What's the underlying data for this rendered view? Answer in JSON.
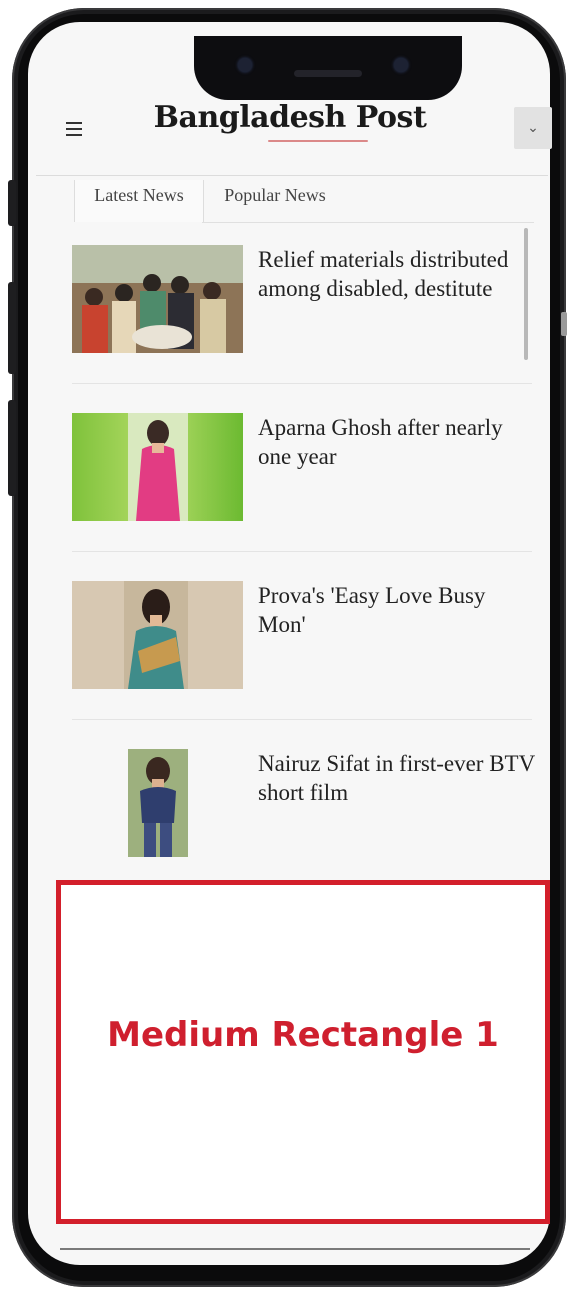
{
  "header": {
    "brand": "Bangladesh Post",
    "menu_icon": "hamburger-menu-icon",
    "dropdown_icon": "chevron-down-icon",
    "dropdown_glyph": "⌄"
  },
  "tabs": [
    {
      "label": "Latest News",
      "active": true
    },
    {
      "label": "Popular News",
      "active": false
    }
  ],
  "news": [
    {
      "headline": "Relief materials distributed among disabled, destitute"
    },
    {
      "headline": "Aparna Ghosh after nearly one year"
    },
    {
      "headline": "Prova's 'Easy Love Busy Mon'"
    },
    {
      "headline": "Nairuz Sifat in first-ever BTV short film"
    }
  ],
  "ad": {
    "label": "Medium Rectangle 1",
    "border_color": "#d31f2b"
  },
  "colors": {
    "frame": "#1b1b1d",
    "ad_text": "#cf1f2e"
  }
}
